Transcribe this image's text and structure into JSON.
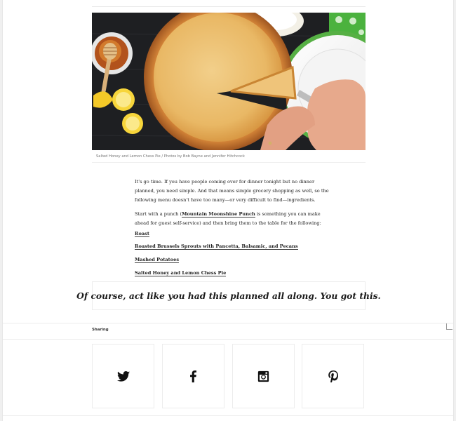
{
  "hero": {
    "caption": "Salted Honey and Lemon Chess Pie / Photos by Bob Bayne and Jennifer Hitchcock"
  },
  "article": {
    "para1": "It's go time. If you have people coming over for dinner tonight but no dinner planned, you need simple. And that means simple grocery shopping as well, so the following menu doesn't have too many—or very difficult to find—ingredients.",
    "para2_before": "Start with a punch (",
    "para2_link": "Mountain Moonshine Punch",
    "para2_after": " is something you can make ahead for guest self-service) and then bring them to the table for the following:",
    "dishes": [
      "Roast",
      "Roasted Brussels Sprouts with Pancetta, Balsamic, and Pecans",
      "Mashed Potatoes",
      "Salted Honey and Lemon Chess Pie"
    ]
  },
  "quote": {
    "text": "Of course, act like you had this planned all along. You got this."
  },
  "sharing": {
    "label": "Sharing",
    "networks": [
      "twitter-icon",
      "facebook-icon",
      "instagram-icon",
      "pinterest-icon"
    ]
  }
}
